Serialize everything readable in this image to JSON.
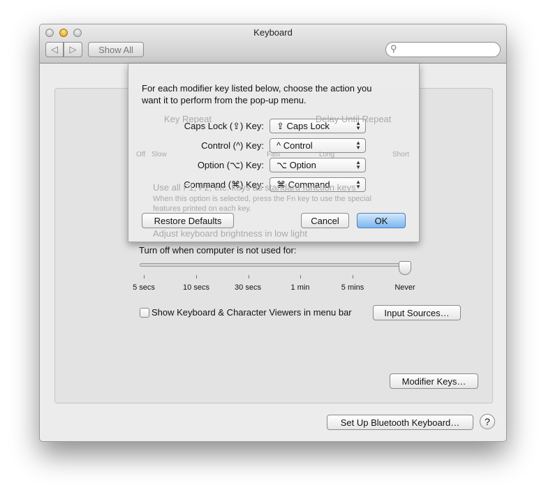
{
  "window": {
    "title": "Keyboard",
    "show_all": "Show All",
    "search_placeholder": ""
  },
  "background": {
    "key_repeat": "Key Repeat",
    "delay": "Delay Until Repeat",
    "off": "Off",
    "slow": "Slow",
    "fast": "Fast",
    "long": "Long",
    "short": "Short",
    "fn_option": "Use all F1, F2, etc. keys as standard function keys",
    "fn_desc1": "When this option is selected, press the Fn key to use the special",
    "fn_desc2": "features printed on each key.",
    "brightness": "Adjust keyboard brightness in low light"
  },
  "sheet": {
    "instructions1": "For each modifier key listed below, choose the action you",
    "instructions2": "want it to perform from the pop-up menu.",
    "rows": [
      {
        "label": "Caps Lock (⇪) Key:",
        "value": "⇪ Caps Lock"
      },
      {
        "label": "Control (^) Key:",
        "value": "^ Control"
      },
      {
        "label": "Option (⌥) Key:",
        "value": "⌥ Option"
      },
      {
        "label": "Command (⌘) Key:",
        "value": "⌘ Command"
      }
    ],
    "restore": "Restore Defaults",
    "cancel": "Cancel",
    "ok": "OK"
  },
  "main": {
    "turn_off_label": "Turn off when computer is not used for:",
    "slider_ticks": [
      "5 secs",
      "10 secs",
      "30 secs",
      "1 min",
      "5 mins",
      "Never"
    ],
    "slider_value": "Never",
    "viewers_checkbox": "Show Keyboard & Character Viewers in menu bar",
    "viewers_checked": false,
    "input_sources": "Input Sources…",
    "modifier_keys": "Modifier Keys…",
    "bluetooth": "Set Up Bluetooth Keyboard…",
    "help": "?"
  }
}
